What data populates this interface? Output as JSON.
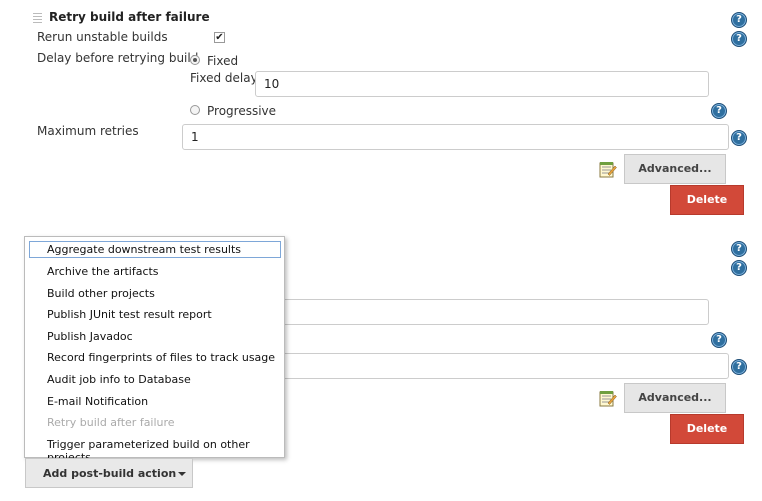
{
  "retry_section": {
    "title": "Retry build after failure",
    "rerun_label": "Rerun unstable builds",
    "rerun_checked": true,
    "delay_label": "Delay before retrying build",
    "fixed_label": "Fixed",
    "fixed_delay_label": "Fixed delay",
    "fixed_delay_value": "10",
    "progressive_label": "Progressive",
    "selected_delay": "Fixed",
    "max_retries_label": "Maximum retries",
    "max_retries_value": "1",
    "advanced_label": "Advanced...",
    "delete_label": "Delete"
  },
  "second_section": {
    "advanced_label": "Advanced...",
    "delete_label": "Delete"
  },
  "dropdown": {
    "items": [
      {
        "label": "Aggregate downstream test results",
        "enabled": true,
        "focused": true
      },
      {
        "label": "Archive the artifacts",
        "enabled": true
      },
      {
        "label": "Build other projects",
        "enabled": true
      },
      {
        "label": "Publish JUnit test result report",
        "enabled": true
      },
      {
        "label": "Publish Javadoc",
        "enabled": true
      },
      {
        "label": "Record fingerprints of files to track usage",
        "enabled": true
      },
      {
        "label": "Audit job info to Database",
        "enabled": true
      },
      {
        "label": "E-mail Notification",
        "enabled": true
      },
      {
        "label": "Retry build after failure",
        "enabled": false
      },
      {
        "label": "Trigger parameterized build on other projects",
        "enabled": true
      }
    ]
  },
  "add_post_build_label": "Add post-build action",
  "colors": {
    "delete": "#d24939",
    "help": "#2f6f9f",
    "focus_border": "#7ea7d8"
  },
  "icons": {
    "help": "question-mark-circle",
    "notepad": "notepad-pencil",
    "grip": "drag-handle",
    "caret": "caret-down"
  }
}
